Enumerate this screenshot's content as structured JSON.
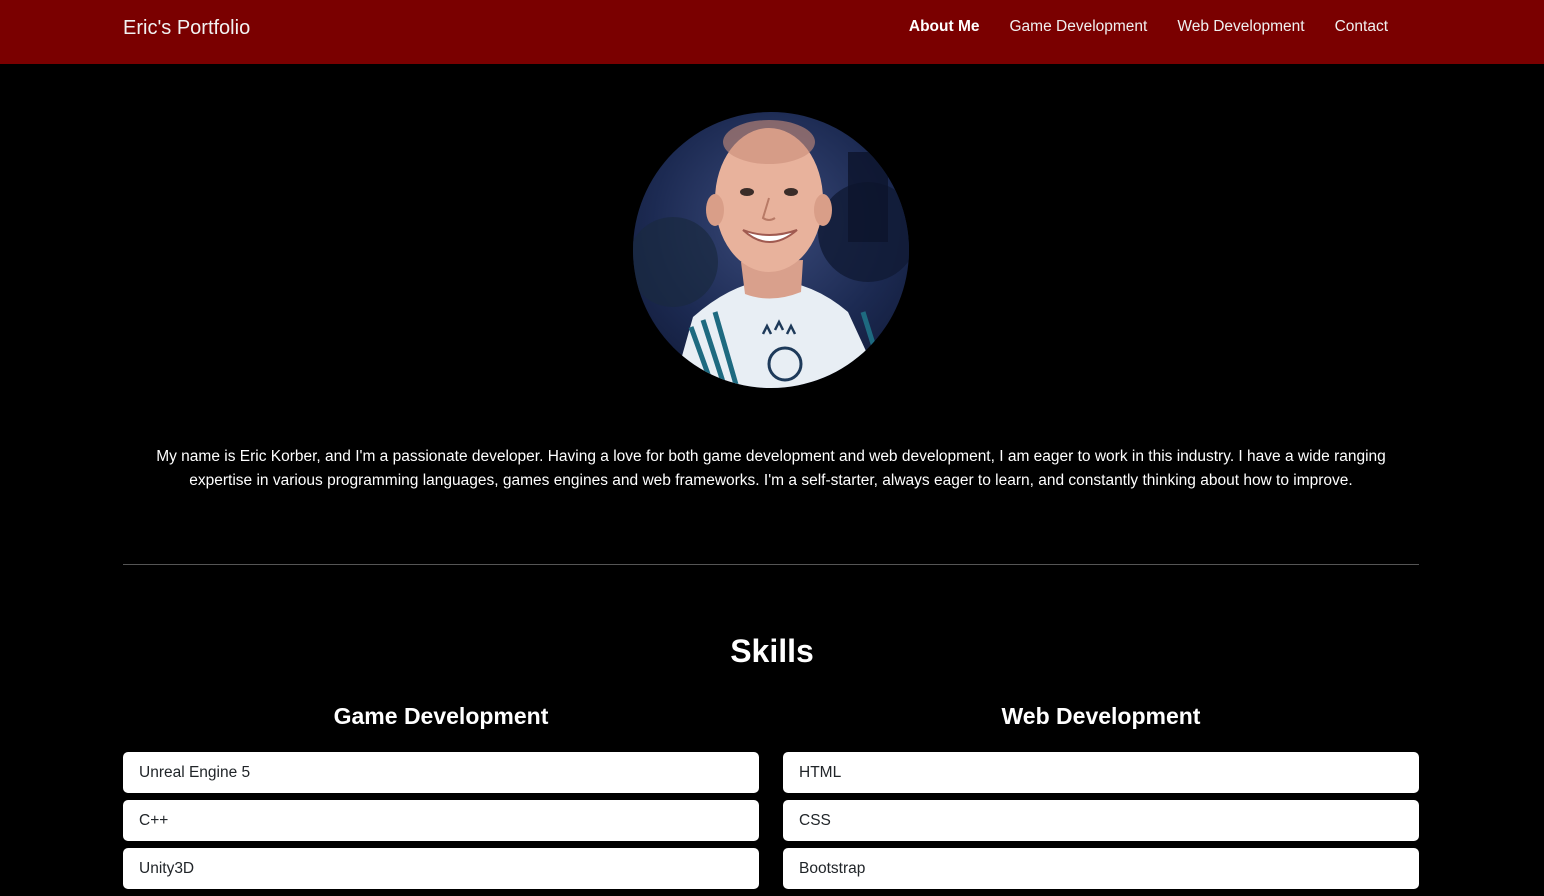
{
  "nav": {
    "brand": "Eric's Portfolio",
    "links": [
      {
        "label": "About Me",
        "active": true
      },
      {
        "label": "Game Development",
        "active": false
      },
      {
        "label": "Web Development",
        "active": false
      },
      {
        "label": "Contact",
        "active": false
      }
    ]
  },
  "colors": {
    "navbar": "#7a0000",
    "background": "#000000",
    "card": "#ffffff"
  },
  "profile": {
    "image_icon": "profile-photo"
  },
  "bio": "My name is Eric Korber, and I'm a passionate developer. Having a love for both game development and web development, I am eager to work in this industry. I have a wide ranging expertise in various programming languages, games engines and web frameworks. I'm a self-starter, always eager to learn, and constantly thinking about how to improve.",
  "skills": {
    "title": "Skills",
    "game": {
      "title": "Game Development",
      "items": [
        "Unreal Engine 5",
        "C++",
        "Unity3D"
      ]
    },
    "web": {
      "title": "Web Development",
      "items": [
        "HTML",
        "CSS",
        "Bootstrap"
      ]
    }
  }
}
